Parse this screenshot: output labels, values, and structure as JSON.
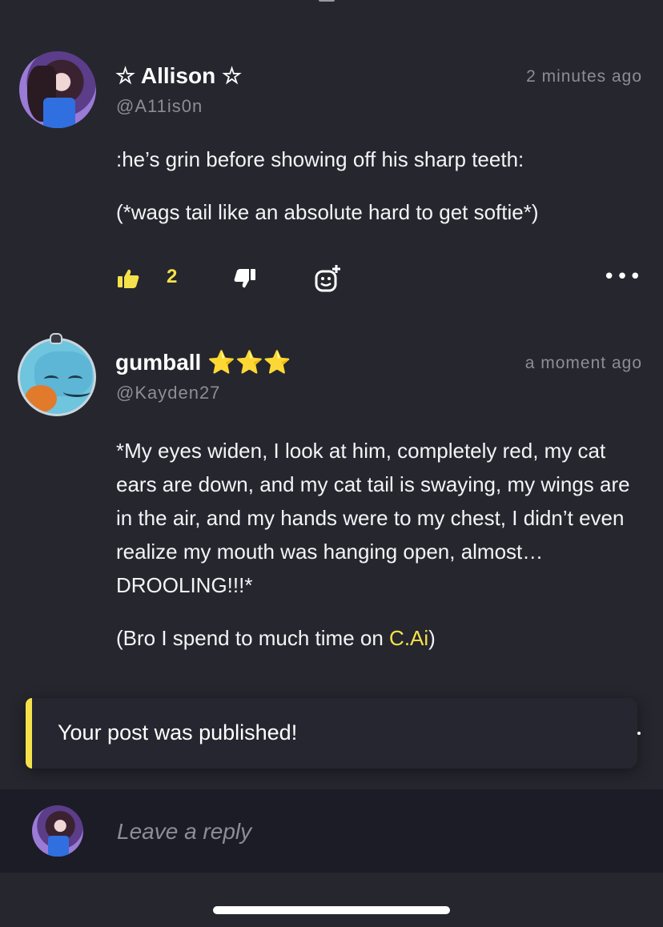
{
  "posts": [
    {
      "author": "☆ Allison ☆",
      "handle": "@A11is0n",
      "time": "2 minutes ago",
      "paragraphs": [
        ":he’s grin before showing off his sharp teeth:",
        "(*wags tail like an absolute hard to get softie*)"
      ],
      "likes": "2",
      "icons": [
        "thumbs-up-icon",
        "thumbs-down-icon",
        "add-reaction-icon",
        "more-icon"
      ]
    },
    {
      "author": "gumball",
      "author_stars": "⭐⭐⭐",
      "handle": "@Kayden27",
      "time": "a moment ago",
      "paragraphs": [
        "*My eyes widen, I look at him, completely red, my cat ears are down, and my cat tail is swaying, my wings are in the air, and my hands were to my chest, I didn’t even realize my mouth was hanging open, almost… DROOLING!!!*"
      ],
      "last_paragraph_prefix": "(Bro I spend to much time on ",
      "last_paragraph_highlight": "C.Ai",
      "last_paragraph_suffix": ")"
    }
  ],
  "toast": {
    "message": "Your post was published!"
  },
  "reply": {
    "placeholder": "Leave a reply"
  },
  "colors": {
    "background": "#26262f",
    "accent": "#f5e24a",
    "muted": "#8d8d97",
    "reply_bar": "#1c1c26"
  }
}
